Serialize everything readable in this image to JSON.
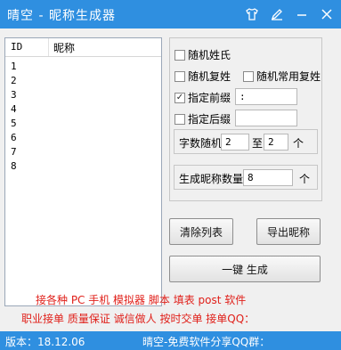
{
  "window": {
    "title": "晴空 - 昵称生成器",
    "icons": [
      "tshirt-icon",
      "pen-icon",
      "minimize-icon",
      "close-icon"
    ]
  },
  "list": {
    "headers": {
      "id": "ID",
      "name": "昵称"
    },
    "rows": [
      "1",
      "2",
      "3",
      "4",
      "5",
      "6",
      "7",
      "8"
    ]
  },
  "options": {
    "random_surname": {
      "label": "随机姓氏",
      "checked": false
    },
    "random_compound": {
      "label": "随机复姓",
      "checked": false
    },
    "random_common_compound": {
      "label": "随机常用复姓",
      "checked": false
    },
    "prefix": {
      "label": "指定前缀",
      "checked": true,
      "value": ":"
    },
    "suffix": {
      "label": "指定后缀",
      "checked": false,
      "value": ""
    }
  },
  "char_count": {
    "label": "字数随机",
    "from": "2",
    "to_label": "至",
    "to": "2",
    "unit": "个"
  },
  "gen_count": {
    "label": "生成昵称数量",
    "value": "8",
    "unit": "个"
  },
  "buttons": {
    "clear": "清除列表",
    "export": "导出昵称",
    "generate": "一键 生成"
  },
  "ads": {
    "line1": "接各种 PC 手机 模拟器 脚本 填表 post 软件",
    "line2": "职业接单 质量保证 诚信做人 按时交单 接单QQ："
  },
  "status": {
    "version": "版本：18.12.06",
    "qq_group": "晴空-免费软件分享QQ群："
  },
  "colors": {
    "titlebar": "#2f8fe0",
    "ad_text": "#e0201a"
  }
}
